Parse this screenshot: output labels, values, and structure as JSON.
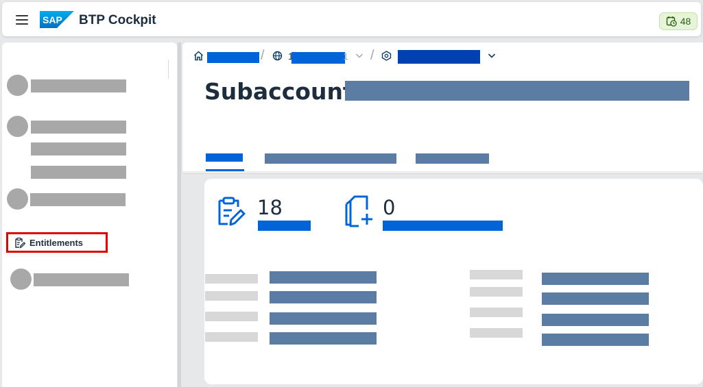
{
  "shellbar": {
    "product": "BTP Cockpit",
    "logo_text": "SAP",
    "notification_count": "48"
  },
  "sidenav": {
    "entitlements_label": "Entitlements"
  },
  "breadcrumb": {
    "partial_char": "1",
    "partial_suffix": "1"
  },
  "page": {
    "title_prefix": "Subaccount:"
  },
  "kpis": [
    {
      "value": "18",
      "icon": "clipboard-edit-icon"
    },
    {
      "value": "0",
      "icon": "add-document-icon"
    }
  ],
  "colors": {
    "accent": "#0064d9",
    "redacted_slate": "#5b7da3",
    "redacted_gray": "#a8a8a8",
    "highlight_border": "#e00000",
    "badge_bg": "#e6f4d7"
  }
}
